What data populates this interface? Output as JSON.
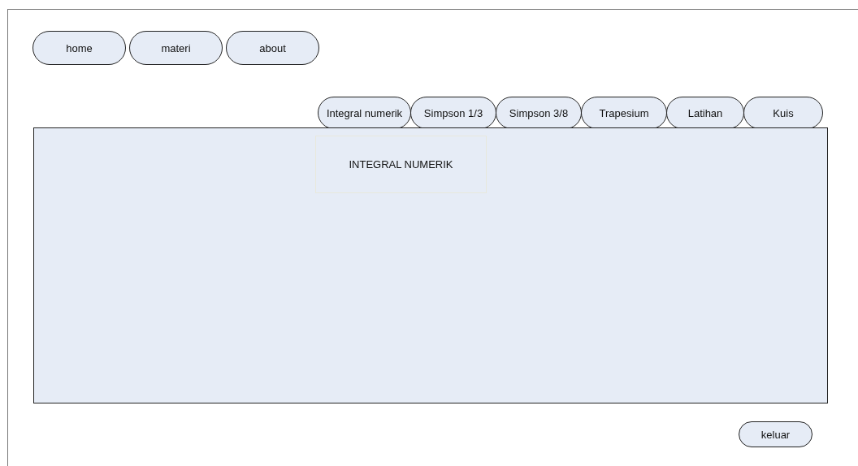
{
  "nav": [
    "home",
    "materi",
    "about"
  ],
  "tabs": [
    {
      "label": "Integral numerik"
    },
    {
      "label": "Simpson 1/3"
    },
    {
      "label": "Simpson 3/8"
    },
    {
      "label": "Trapesium"
    },
    {
      "label": "Latihan"
    },
    {
      "label": "Kuis"
    }
  ],
  "panel": {
    "heading": "INTEGRAL NUMERIK"
  },
  "exit_button": "keluar"
}
